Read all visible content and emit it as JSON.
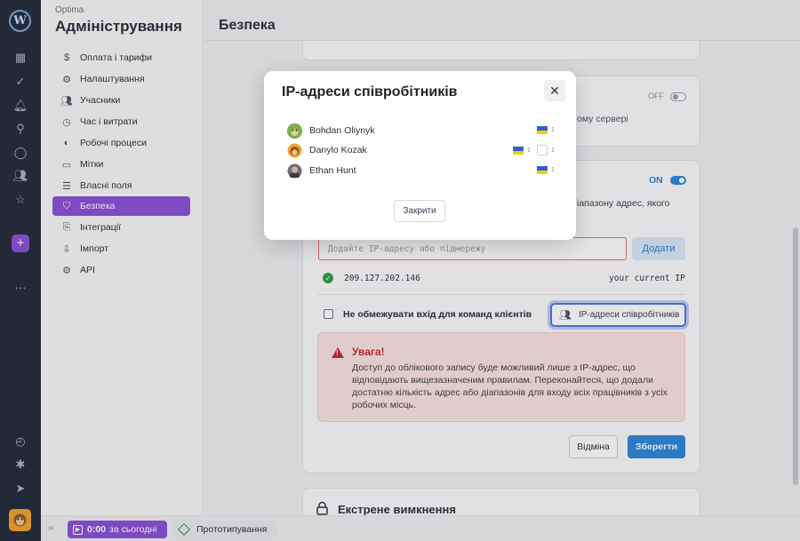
{
  "app": {
    "name": "Optima",
    "section_title": "Адміністрування"
  },
  "nav": {
    "items": [
      {
        "label": "Оплата і тарифи",
        "icon": "dollar-icon"
      },
      {
        "label": "Налаштування",
        "icon": "gear-icon"
      },
      {
        "label": "Учасники",
        "icon": "users-icon"
      },
      {
        "label": "Час і витрати",
        "icon": "clock-icon"
      },
      {
        "label": "Робочі процеси",
        "icon": "workflow-icon"
      },
      {
        "label": "Мітки",
        "icon": "tag-icon"
      },
      {
        "label": "Власні поля",
        "icon": "fields-icon"
      },
      {
        "label": "Безпека",
        "icon": "shield-icon",
        "active": true
      },
      {
        "label": "Інтеграції",
        "icon": "integration-icon"
      },
      {
        "label": "Імпорт",
        "icon": "import-icon"
      },
      {
        "label": "API",
        "icon": "api-icon"
      }
    ]
  },
  "page": {
    "title": "Безпека"
  },
  "security": {
    "top_toggle_state": "OFF",
    "top_card_fragment": "ому сервері",
    "ip_toggle_state": "ON",
    "ip_card_fragment": "іапазону адрес, якого",
    "ip_placeholder": "Додайте IP-адресу або підмережу",
    "add_button": "Додати",
    "ip_entry": "209.127.202.146",
    "ip_entry_note": "your current IP",
    "no_restrict_label": "Не обмежувати вхід для команд клієнтів",
    "employee_ips_button": "IP-адреси співробітників",
    "warning_title": "Увага!",
    "warning_text": "Доступ до облікового запису буде можливий лише з IP-адрес, що відповідають вищезазначеним правилам. Переконайтеся, що додали достатню кількість адрес або діапазонів для входу всіх працівників з усіх робочих місць.",
    "cancel_button": "Відміна",
    "save_button": "Зберегти",
    "emergency_title": "Екстрене вимкнення"
  },
  "bottom_bar": {
    "timer_value": "0:00",
    "timer_suffix": "за сьогодні",
    "project": "Прототипування"
  },
  "modal": {
    "title": "IP-адреси співробітників",
    "people": [
      {
        "name": "Bohdan Oliynyk",
        "flags": [
          {
            "country": "UA",
            "count": "1"
          }
        ]
      },
      {
        "name": "Danylo Kozak",
        "flags": [
          {
            "country": "UA",
            "count": "1"
          },
          {
            "country": "unknown",
            "count": "1"
          }
        ]
      },
      {
        "name": "Ethan Hunt",
        "flags": [
          {
            "country": "UA",
            "count": "1"
          }
        ]
      }
    ],
    "close_button": "Закрити"
  },
  "colors": {
    "accent": "#8a4fd6",
    "primary": "#2b86d9",
    "danger": "#c92a2a",
    "success": "#2f9e44"
  }
}
